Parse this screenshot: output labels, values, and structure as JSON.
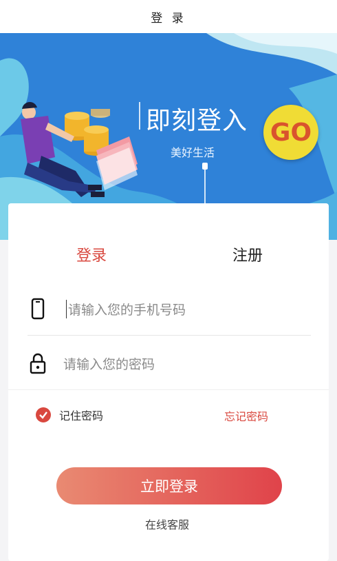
{
  "header": {
    "title": "登 录"
  },
  "banner": {
    "headline": "即刻登入",
    "subtitle": "美好生活",
    "go_label": "GO"
  },
  "tabs": {
    "login": "登录",
    "register": "注册"
  },
  "form": {
    "phone_placeholder": "请输入您的手机号码",
    "password_placeholder": "请输入您的密码",
    "remember_label": "记住密码",
    "forgot_label": "忘记密码",
    "submit_label": "立即登录",
    "service_label": "在线客服"
  },
  "colors": {
    "accent": "#d9483f",
    "banner": "#2d7fd6",
    "go": "#f0dc35"
  }
}
